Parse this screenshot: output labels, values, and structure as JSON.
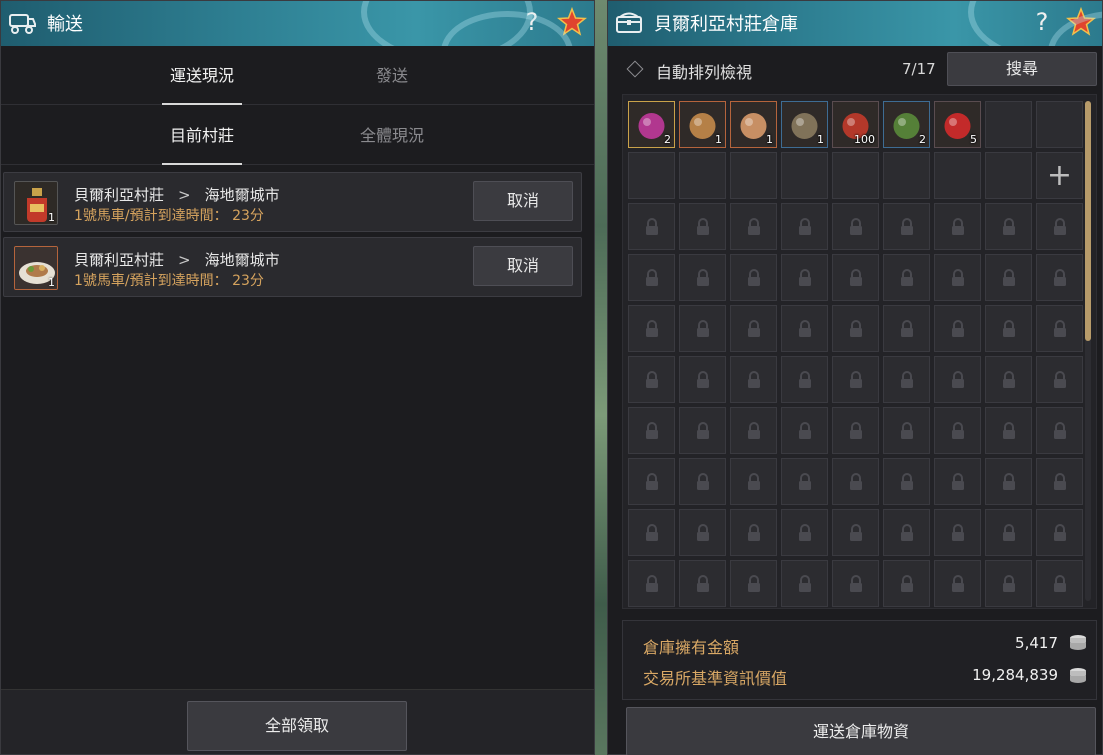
{
  "transport": {
    "title": "輸送",
    "help": "?",
    "tabs": [
      "運送現況",
      "發送"
    ],
    "subtabs": [
      "目前村莊",
      "全體現況"
    ],
    "deliveries": [
      {
        "icon": "potion-item-icon",
        "qty": "1",
        "from": "貝爾利亞村莊",
        "arrow": ">",
        "to": "海地爾城市",
        "eta": "1號馬車/預計到達時間： 23分",
        "cancel": "取消"
      },
      {
        "icon": "food-plate-item-icon",
        "qty": "1",
        "from": "貝爾利亞村莊",
        "arrow": ">",
        "to": "海地爾城市",
        "eta": "1號馬車/預計到達時間： 23分",
        "cancel": "取消"
      }
    ],
    "claim_all": "全部領取"
  },
  "storage": {
    "title": "貝爾利亞村莊倉庫",
    "help": "?",
    "sort_label": "自動排列檢視",
    "count": "7/17",
    "search": "搜尋",
    "items": [
      {
        "icon": "pink-elixir-icon",
        "qty": "2",
        "frame": "gold",
        "color": "#c0389a"
      },
      {
        "icon": "meal-plate-icon",
        "qty": "1",
        "frame": "orange",
        "color": "#c48a4a"
      },
      {
        "icon": "meal-plate-icon",
        "qty": "1",
        "frame": "orange",
        "color": "#d89a6a"
      },
      {
        "icon": "meat-pile-icon",
        "qty": "1",
        "frame": "blue",
        "color": "#8a7a5e"
      },
      {
        "icon": "red-potion-bottle-icon",
        "qty": "100",
        "frame": "plain",
        "color": "#c23a2a"
      },
      {
        "icon": "herb-bowl-icon",
        "qty": "2",
        "frame": "blue",
        "color": "#5a8a3a"
      },
      {
        "icon": "red-vial-icon",
        "qty": "5",
        "frame": "plain",
        "color": "#d42a2a"
      }
    ],
    "money_label": "倉庫擁有金額",
    "money_value": "5,417",
    "market_label": "交易所基準資訊價值",
    "market_value": "19,284,839",
    "ship_button": "運送倉庫物資"
  }
}
